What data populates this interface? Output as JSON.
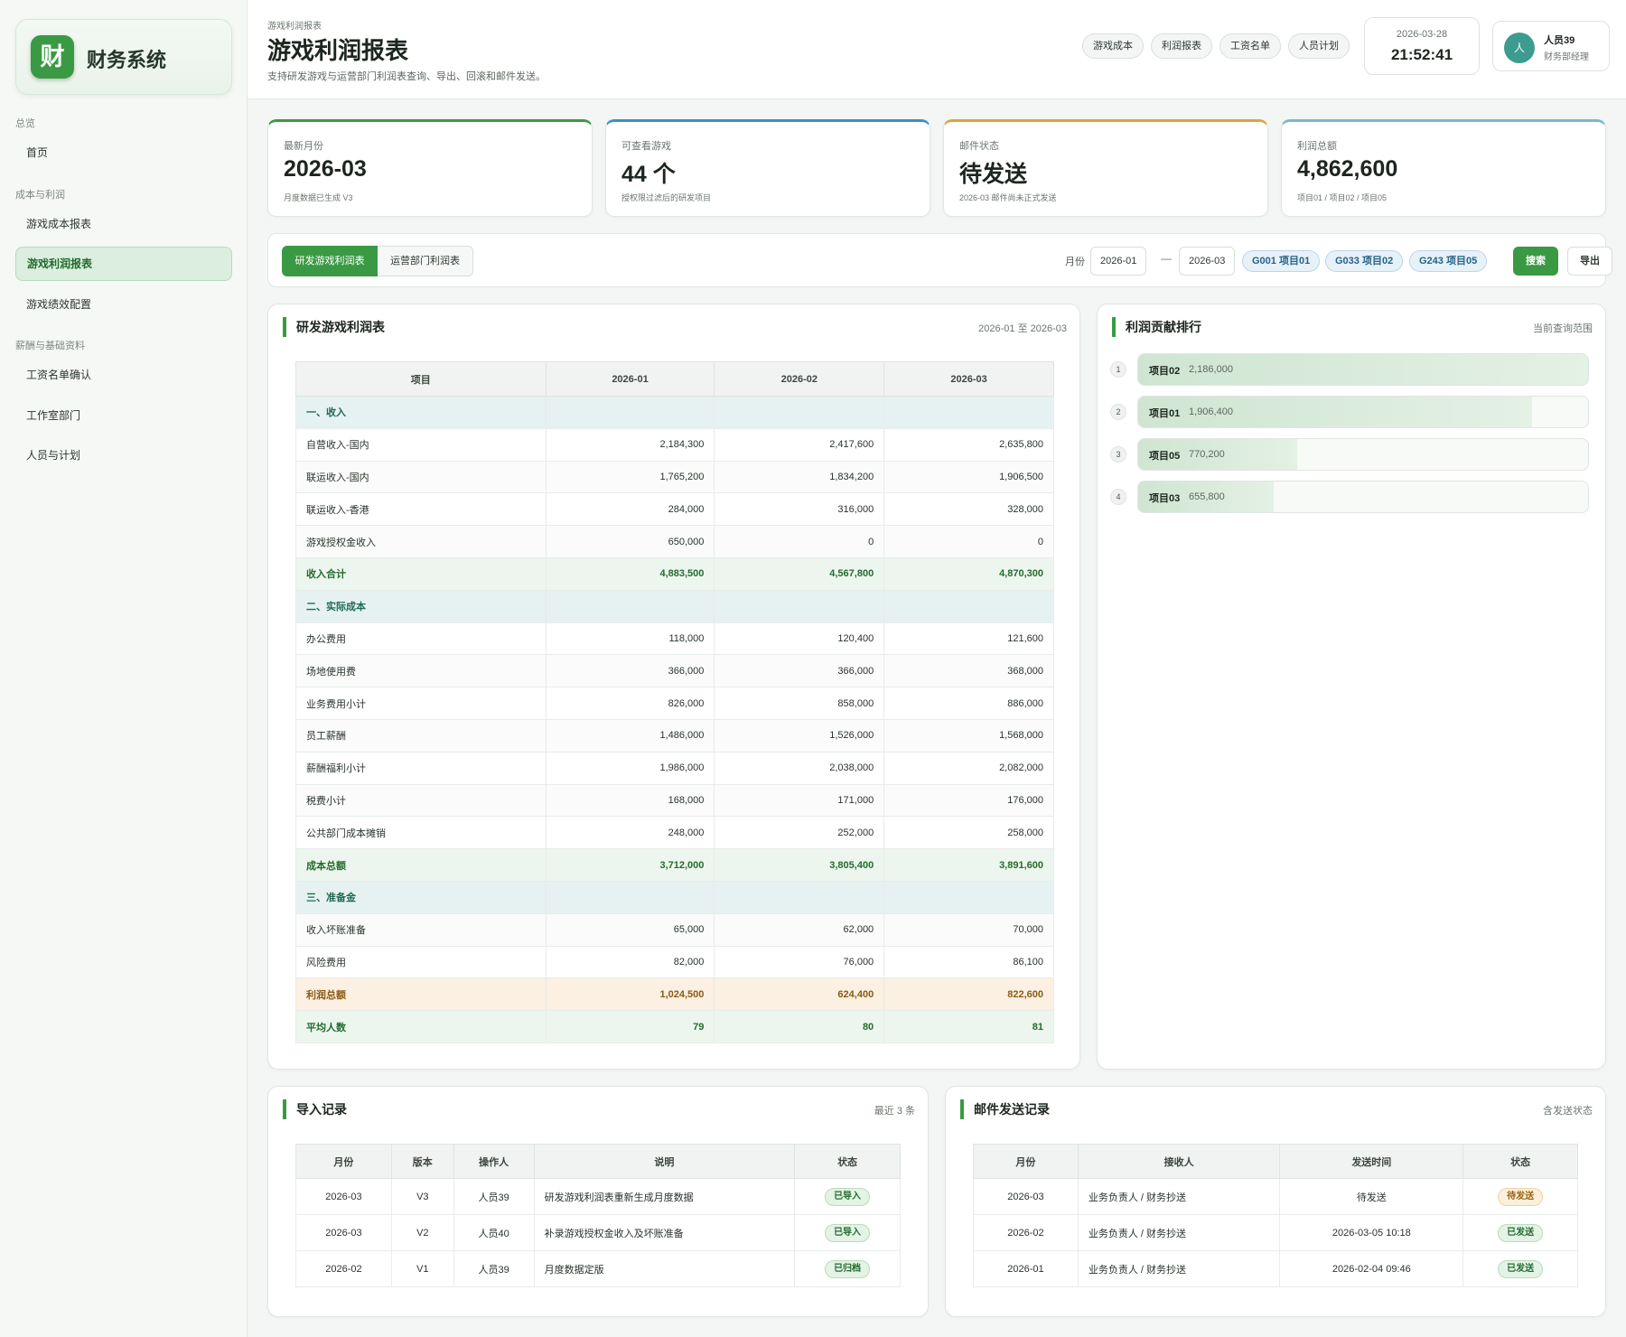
{
  "app": {
    "logo_char": "财",
    "title": "财务系统"
  },
  "sidebar": {
    "groups": [
      {
        "label": "总览",
        "items": [
          "首页"
        ]
      },
      {
        "label": "成本与利润",
        "items": [
          "游戏成本报表",
          "游戏利润报表",
          "游戏绩效配置"
        ]
      },
      {
        "label": "薪酬与基础资料",
        "items": [
          "工资名单确认",
          "工作室部门",
          "人员与计划"
        ]
      }
    ],
    "active": "游戏利润报表"
  },
  "header": {
    "breadcrumb": "游戏利润报表",
    "title": "游戏利润报表",
    "subtitle": "支持研发游戏与运营部门利润表查询、导出、回滚和邮件发送。",
    "quick_links": [
      "游戏成本",
      "利润报表",
      "工资名单",
      "人员计划"
    ],
    "date": "2026-03-28",
    "time": "21:52:41",
    "user": {
      "avatar": "人",
      "name": "人员39",
      "role": "财务部经理"
    }
  },
  "stats": [
    {
      "label": "最新月份",
      "value": "2026-03",
      "sub": "月度数据已生成 V3",
      "accent": "#3a9a44"
    },
    {
      "label": "可查看游戏",
      "value": "44 个",
      "sub": "授权限过滤后的研发项目",
      "accent": "#3d8fc4"
    },
    {
      "label": "邮件状态",
      "value": "待发送",
      "sub": "2026-03 邮件尚未正式发送",
      "accent": "#e0a33c"
    },
    {
      "label": "利润总额",
      "value": "4,862,600",
      "sub": "项目01 / 项目02 / 项目05",
      "accent": "#7bb8c9"
    }
  ],
  "filter": {
    "tabs": [
      "研发游戏利润表",
      "运营部门利润表"
    ],
    "month_label": "月份",
    "from": "2026-01",
    "dash": "—",
    "to": "2026-03",
    "games": [
      "G001 项目01",
      "G033 项目02",
      "G243 项目05"
    ],
    "search_label": "搜索",
    "export_label": "导出"
  },
  "profit_table": {
    "title": "研发游戏利润表",
    "range": "2026-01 至 2026-03",
    "headers": [
      "项目",
      "2026-01",
      "2026-02",
      "2026-03"
    ],
    "rows": [
      {
        "type": "sec",
        "cells": [
          "一、收入",
          "",
          "",
          ""
        ]
      },
      {
        "type": "",
        "cells": [
          "自营收入-国内",
          "2,184,300",
          "2,417,600",
          "2,635,800"
        ]
      },
      {
        "type": "alt",
        "cells": [
          "联运收入-国内",
          "1,765,200",
          "1,834,200",
          "1,906,500"
        ]
      },
      {
        "type": "",
        "cells": [
          "联运收入-香港",
          "284,000",
          "316,000",
          "328,000"
        ]
      },
      {
        "type": "alt",
        "cells": [
          "游戏授权金收入",
          "650,000",
          "0",
          "0"
        ]
      },
      {
        "type": "tot",
        "cells": [
          "收入合计",
          "4,883,500",
          "4,567,800",
          "4,870,300"
        ]
      },
      {
        "type": "sec",
        "cells": [
          "二、实际成本",
          "",
          "",
          ""
        ]
      },
      {
        "type": "",
        "cells": [
          "办公费用",
          "118,000",
          "120,400",
          "121,600"
        ]
      },
      {
        "type": "alt",
        "cells": [
          "场地使用费",
          "366,000",
          "366,000",
          "368,000"
        ]
      },
      {
        "type": "",
        "cells": [
          "业务费用小计",
          "826,000",
          "858,000",
          "886,000"
        ]
      },
      {
        "type": "alt",
        "cells": [
          "员工薪酬",
          "1,486,000",
          "1,526,000",
          "1,568,000"
        ]
      },
      {
        "type": "",
        "cells": [
          "薪酬福利小计",
          "1,986,000",
          "2,038,000",
          "2,082,000"
        ]
      },
      {
        "type": "alt",
        "cells": [
          "税费小计",
          "168,000",
          "171,000",
          "176,000"
        ]
      },
      {
        "type": "",
        "cells": [
          "公共部门成本摊销",
          "248,000",
          "252,000",
          "258,000"
        ]
      },
      {
        "type": "tot",
        "cells": [
          "成本总额",
          "3,712,000",
          "3,805,400",
          "3,891,600"
        ]
      },
      {
        "type": "sec",
        "cells": [
          "三、准备金",
          "",
          "",
          ""
        ]
      },
      {
        "type": "alt",
        "cells": [
          "收入坏账准备",
          "65,000",
          "62,000",
          "70,000"
        ]
      },
      {
        "type": "",
        "cells": [
          "风险费用",
          "82,000",
          "76,000",
          "86,100"
        ]
      },
      {
        "type": "profit",
        "cells": [
          "利润总额",
          "1,024,500",
          "624,400",
          "822,600"
        ]
      },
      {
        "type": "avg",
        "cells": [
          "平均人数",
          "79",
          "80",
          "81"
        ]
      }
    ]
  },
  "ranking": {
    "title": "利润贡献排行",
    "meta": "当前查询范围",
    "items": [
      {
        "rank": "1",
        "name": "项目02",
        "value": "2,186,000",
        "share": 1.0
      },
      {
        "rank": "2",
        "name": "项目01",
        "value": "1,906,400",
        "share": 0.872
      },
      {
        "rank": "3",
        "name": "项目05",
        "value": "770,200",
        "share": 0.352
      },
      {
        "rank": "4",
        "name": "项目03",
        "value": "655,800",
        "share": 0.3
      }
    ]
  },
  "imports": {
    "title": "导入记录",
    "meta": "最近 3 条",
    "headers": [
      "月份",
      "版本",
      "操作人",
      "说明",
      "状态"
    ],
    "rows": [
      {
        "cells": [
          "2026-03",
          "V3",
          "人员39",
          "研发游戏利润表重新生成月度数据"
        ],
        "status": "已导入",
        "tone": "green"
      },
      {
        "cells": [
          "2026-03",
          "V2",
          "人员40",
          "补录游戏授权金收入及坏账准备"
        ],
        "status": "已导入",
        "tone": "green"
      },
      {
        "cells": [
          "2026-02",
          "V1",
          "人员39",
          "月度数据定版"
        ],
        "status": "已归档",
        "tone": "green"
      }
    ]
  },
  "mails": {
    "title": "邮件发送记录",
    "meta": "含发送状态",
    "headers": [
      "月份",
      "接收人",
      "发送时间",
      "状态"
    ],
    "rows": [
      {
        "cells": [
          "2026-03",
          "业务负责人 / 财务抄送",
          "待发送"
        ],
        "status": "待发送",
        "tone": "orange"
      },
      {
        "cells": [
          "2026-02",
          "业务负责人 / 财务抄送",
          "2026-03-05 10:18"
        ],
        "status": "已发送",
        "tone": "green"
      },
      {
        "cells": [
          "2026-01",
          "业务负责人 / 财务抄送",
          "2026-02-04 09:46"
        ],
        "status": "已发送",
        "tone": "green"
      }
    ]
  },
  "icons": {
    "logo": "finance-logo-icon",
    "avatar": "user-avatar-icon"
  }
}
